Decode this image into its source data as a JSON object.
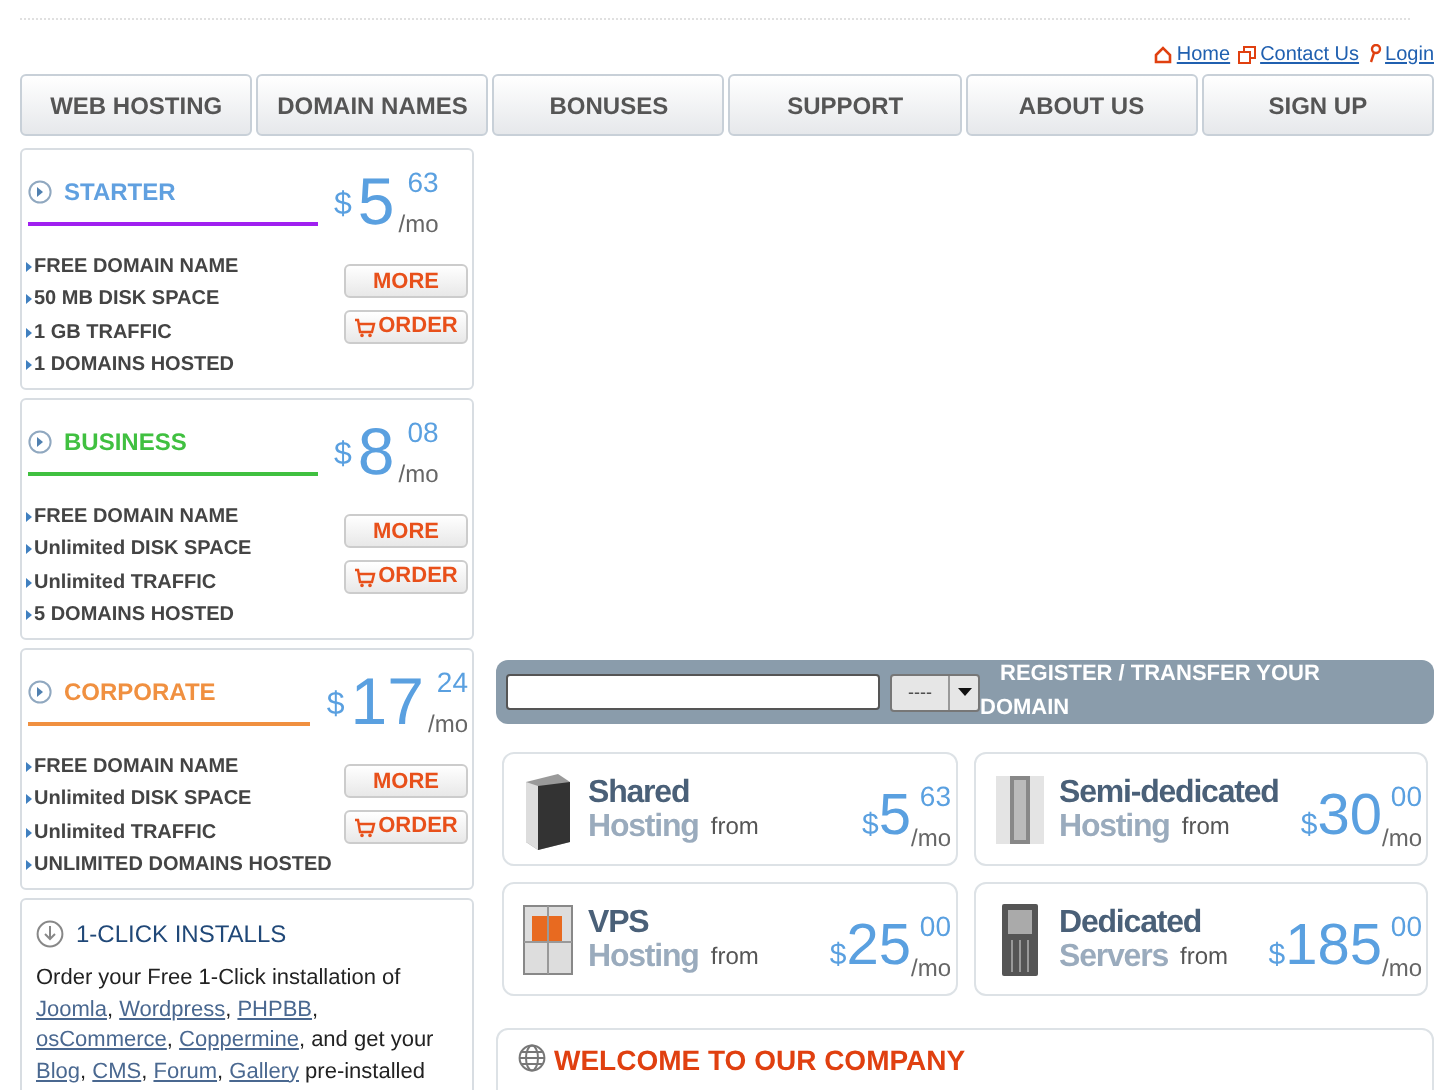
{
  "top_links": [
    {
      "label": "Home",
      "kind": "home"
    },
    {
      "label": "Contact Us",
      "kind": "contact"
    },
    {
      "label": "Login",
      "kind": "login"
    }
  ],
  "nav": [
    {
      "label": "WEB HOSTING"
    },
    {
      "label": "DOMAIN NAMES"
    },
    {
      "label": "BONUSES"
    },
    {
      "label": "SUPPORT"
    },
    {
      "label": "ABOUT US"
    },
    {
      "label": "SIGN UP"
    }
  ],
  "plans": [
    {
      "name": "STARTER",
      "kind": "plain",
      "color": "#a020f0",
      "currency": "$",
      "price": "5",
      "cents": "63",
      "per": "/mo",
      "features": [
        "FREE DOMAIN NAME",
        "50 MB DISK SPACE",
        "1 GB TRAFFIC",
        "1 DOMAINS HOSTED"
      ],
      "more": "MORE",
      "order": "ORDER"
    },
    {
      "name": "BUSINESS",
      "kind": "accent",
      "color": "#40c040",
      "currency": "$",
      "price": "8",
      "cents": "08",
      "per": "/mo",
      "features": [
        "FREE DOMAIN NAME",
        "Unlimited DISK SPACE",
        "Unlimited TRAFFIC",
        "5 DOMAINS HOSTED"
      ],
      "more": "MORE",
      "order": "ORDER"
    },
    {
      "name": "CORPORATE",
      "kind": "accent",
      "color": "#f09040",
      "currency": "$",
      "price": "17",
      "cents": "24",
      "per": "/mo",
      "features": [
        "FREE DOMAIN NAME",
        "Unlimited DISK SPACE",
        "Unlimited TRAFFIC",
        "UNLIMITED DOMAINS HOSTED"
      ],
      "more": "MORE",
      "order": "ORDER"
    }
  ],
  "installs": {
    "title": "1-CLICK INSTALLS",
    "text": [
      {
        "kind": "text",
        "text": "Order your Free 1-Click installation of "
      },
      {
        "kind": "link",
        "text": "Joomla"
      },
      {
        "kind": "text",
        "text": ", "
      },
      {
        "kind": "link",
        "text": "Wordpress"
      },
      {
        "kind": "text",
        "text": ", "
      },
      {
        "kind": "link",
        "text": "PHPBB"
      },
      {
        "kind": "text",
        "text": ", "
      },
      {
        "kind": "link",
        "text": "osCommerce"
      },
      {
        "kind": "text",
        "text": ", "
      },
      {
        "kind": "link",
        "text": "Coppermine"
      },
      {
        "kind": "text",
        "text": ", and get your "
      },
      {
        "kind": "link",
        "text": "Blog"
      },
      {
        "kind": "text",
        "text": ", "
      },
      {
        "kind": "link",
        "text": "CMS"
      },
      {
        "kind": "text",
        "text": ", "
      },
      {
        "kind": "link",
        "text": "Forum"
      },
      {
        "kind": "text",
        "text": ", "
      },
      {
        "kind": "link",
        "text": "Gallery"
      },
      {
        "kind": "text",
        "text": " pre-installed"
      }
    ]
  },
  "domain": {
    "select": "----",
    "label": "REGISTER / TRANSFER YOUR DOMAIN"
  },
  "hosting": [
    {
      "kind": "tower",
      "line1": "Shared",
      "line2": "Hosting",
      "from": "from",
      "currency": "$",
      "price": "5",
      "cents": "63",
      "per": "/mo"
    },
    {
      "kind": "rack",
      "line1": "Semi-dedicated",
      "line2": "Hosting",
      "from": "from",
      "currency": "$",
      "price": "30",
      "cents": "00",
      "per": "/mo"
    },
    {
      "kind": "cube",
      "line1": "VPS",
      "line2": "Hosting",
      "from": "from",
      "currency": "$",
      "price": "25",
      "cents": "00",
      "per": "/mo"
    },
    {
      "kind": "server",
      "line1": "Dedicated",
      "line2": "Servers",
      "from": "from",
      "currency": "$",
      "price": "185",
      "cents": "00",
      "per": "/mo"
    }
  ],
  "welcome": {
    "title": "WELCOME TO OUR COMPANY"
  }
}
